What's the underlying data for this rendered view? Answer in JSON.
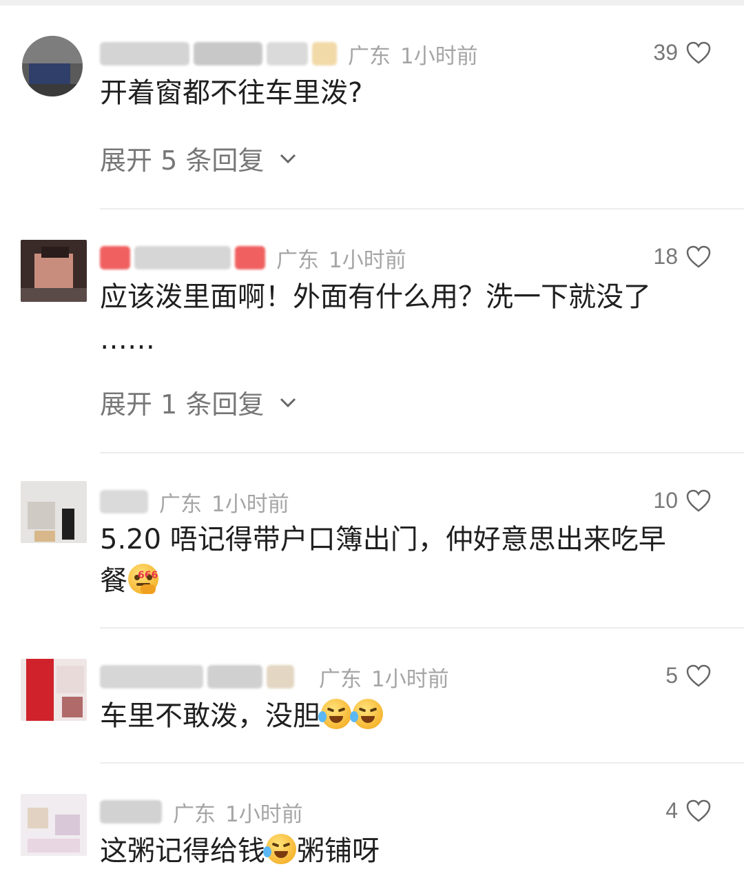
{
  "colors": {
    "meta_text": "#a5a5a5",
    "body_text": "#1f1f1f",
    "secondary_text": "#777777",
    "divider": "#ececec"
  },
  "comments": [
    {
      "location": "广东",
      "time": "1小时前",
      "likes": "39",
      "text": "开着窗都不往车里泼?",
      "expand": "展开 5 条回复"
    },
    {
      "location": "广东",
      "time": "1小时前",
      "likes": "18",
      "text": "应该泼里面啊！外面有什么用？洗一下就没了",
      "text2": "……",
      "expand": "展开 1 条回复"
    },
    {
      "location": "广东",
      "time": "1小时前",
      "likes": "10",
      "text": "5.20 唔记得带户口簿出门，仲好意思出来吃早",
      "text2": "餐",
      "emoji": "thinking-666-emoji"
    },
    {
      "location": "广东",
      "time": "1小时前",
      "likes": "5",
      "text": "车里不敢泼，没胆",
      "emoji": "laugh-cry-emoji"
    },
    {
      "location": "广东",
      "time": "1小时前",
      "likes": "4",
      "text_a": "这粥记得给钱",
      "text_b": "粥铺呀",
      "emoji": "laugh-cry-emoji"
    }
  ]
}
